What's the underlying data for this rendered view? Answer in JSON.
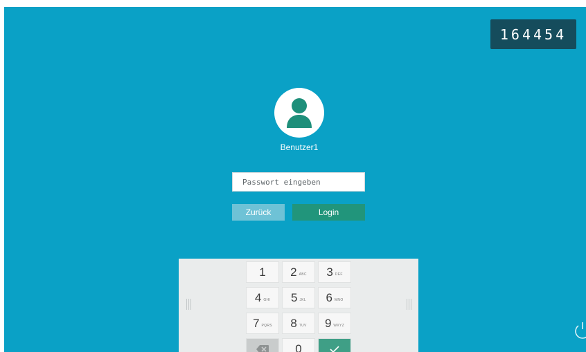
{
  "session_code": "164454",
  "user": {
    "avatar_icon": "person-icon",
    "name": "Benutzer1"
  },
  "password": {
    "placeholder": "Passwort eingeben",
    "value": ""
  },
  "buttons": {
    "back_label": "Zurück",
    "login_label": "Login"
  },
  "keypad": {
    "keys": [
      {
        "digit": "1",
        "letters": ""
      },
      {
        "digit": "2",
        "letters": "ABC"
      },
      {
        "digit": "3",
        "letters": "DEF"
      },
      {
        "digit": "4",
        "letters": "GHI"
      },
      {
        "digit": "5",
        "letters": "JKL"
      },
      {
        "digit": "6",
        "letters": "MNO"
      },
      {
        "digit": "7",
        "letters": "PQRS"
      },
      {
        "digit": "8",
        "letters": "TUV"
      },
      {
        "digit": "9",
        "letters": "WXYZ"
      },
      {
        "digit": "0",
        "letters": ""
      }
    ],
    "backspace_icon": "backspace-icon",
    "confirm_icon": "checkmark-icon"
  },
  "power_icon": "power-icon",
  "colors": {
    "background": "#0aa1c6",
    "session_code_bg": "#154c5c",
    "login_button": "#21957b",
    "back_button": "#6ec2d6",
    "avatar": "#1e8f7a",
    "confirm_key": "#3f9f86"
  }
}
